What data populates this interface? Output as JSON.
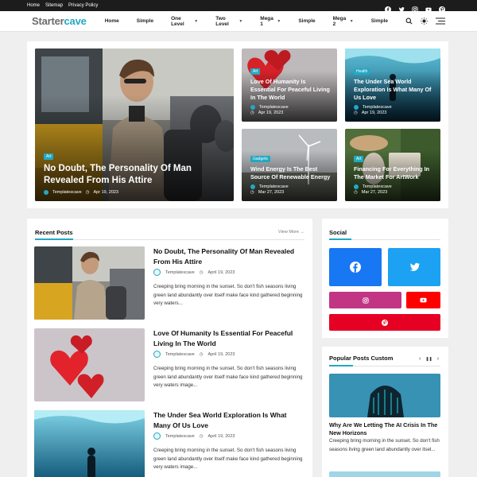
{
  "topbar": {
    "links": [
      "Home",
      "Sitemap",
      "Privacy Policy"
    ],
    "social_icons": [
      "facebook-icon",
      "twitter-icon",
      "instagram-icon",
      "youtube-icon",
      "pinterest-icon"
    ]
  },
  "header": {
    "logo_a": "Starter",
    "logo_b": "cave",
    "nav": [
      {
        "label": "Home",
        "has_dropdown": false
      },
      {
        "label": "Simple",
        "has_dropdown": false
      },
      {
        "label": "One Level",
        "has_dropdown": true
      },
      {
        "label": "Two Level",
        "has_dropdown": true
      },
      {
        "label": "Mega 1",
        "has_dropdown": true
      },
      {
        "label": "Simple",
        "has_dropdown": false
      },
      {
        "label": "Mega 2",
        "has_dropdown": true
      },
      {
        "label": "Simple",
        "has_dropdown": false
      }
    ],
    "icons": [
      "search-icon",
      "theme-toggle-icon",
      "menu-icon"
    ]
  },
  "colors": {
    "accent": "#23a8c2",
    "dark": "#1c1c1c",
    "facebook": "#1877f2",
    "twitter": "#1da1f2",
    "instagram": "#c13584",
    "youtube": "#ff0000",
    "pinterest": "#e60023"
  },
  "featured": {
    "big": {
      "badge": "Art",
      "title": "No Doubt, The Personality Of Man Revealed From His Attire",
      "author": "Templatescave",
      "date": "Apr 19, 2023"
    },
    "small": [
      {
        "badge": "Art",
        "title": "Love Of Humanity Is Essential For Peaceful Living In The World",
        "author": "Templatescave",
        "date": "Apr 19, 2023"
      },
      {
        "badge": "Health",
        "title": "The Under Sea World Exploration Is What Many Of Us Love",
        "author": "Templatescave",
        "date": "Apr 19, 2023"
      },
      {
        "badge": "Gadgets",
        "title": "Wind Energy Is The Best Source Of Renewable Energy",
        "author": "Templatescave",
        "date": "Mar 27, 2023"
      },
      {
        "badge": "Art",
        "title": "Financing For Everything In The Market For ArtWork",
        "author": "Templatescave",
        "date": "Mar 27, 2023"
      }
    ]
  },
  "recent": {
    "heading": "Recent Posts",
    "view_more": "View More →",
    "posts": [
      {
        "title": "No Doubt, The Personality Of Man Revealed From His Attire",
        "author": "Templatescave",
        "date": "April 19, 2023",
        "excerpt": "Creeping bring morning in the sunset. So don't fish seasons living green land abundantly over itself make face kind gathered beginning very waters..."
      },
      {
        "title": "Love Of Humanity Is Essential For Peaceful Living In The World",
        "author": "Templatescave",
        "date": "April 19, 2023",
        "excerpt": "Creeping bring morning in the sunset. So don't fish seasons living green land abundantly over itself make face kind gathered beginning very waters image..."
      },
      {
        "title": "The Under Sea World Exploration Is What Many Of Us Love",
        "author": "Templatescave",
        "date": "April 19, 2023",
        "excerpt": "Creeping bring morning in the sunset. So don't fish seasons living green land abundantly over itself make face kind gathered beginning very waters image..."
      }
    ]
  },
  "social": {
    "heading": "Social"
  },
  "popular": {
    "heading": "Popular Posts Custom",
    "title": "Why Are We Letting The AI Crisis In The New Horizons",
    "excerpt": "Creeping bring morning in the sunset. So don't fish seasons living green land abundantly over itsel..."
  }
}
